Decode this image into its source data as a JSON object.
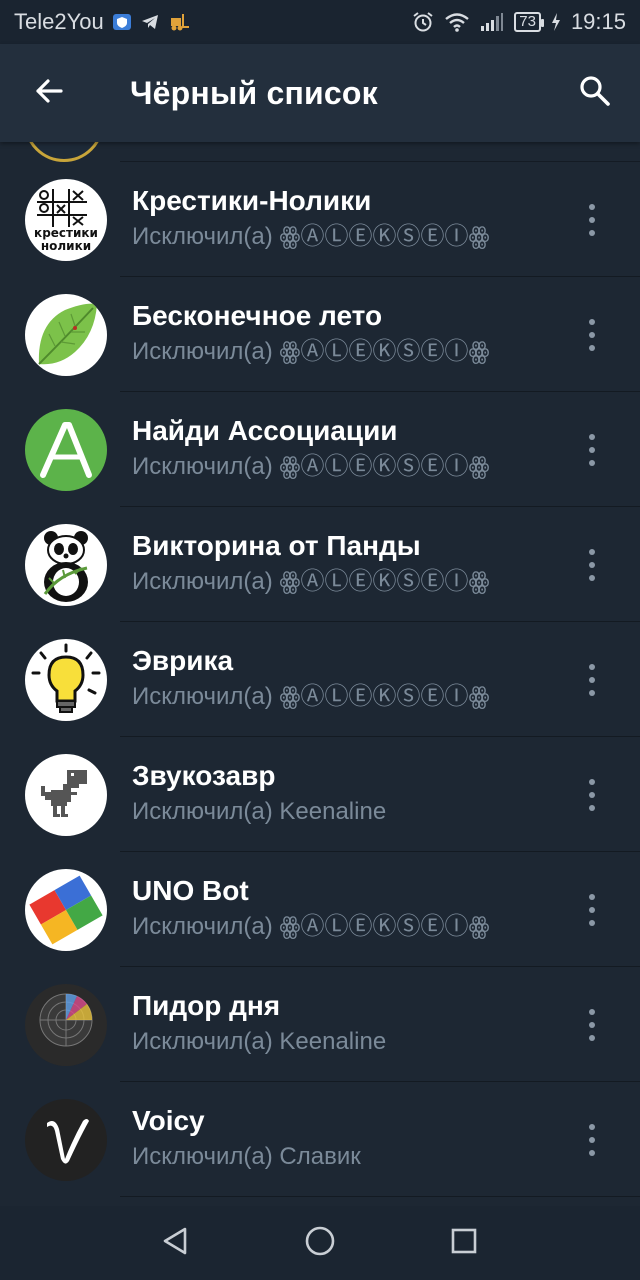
{
  "status_bar": {
    "carrier": "Tele2You",
    "battery": "73",
    "time": "19:15",
    "icons": [
      "shield-icon",
      "telegram-icon",
      "forklift-icon",
      "alarm-icon",
      "wifi-icon",
      "signal-icon",
      "charging-icon"
    ]
  },
  "appbar": {
    "title": "Чёрный список",
    "back_icon": "arrow-back-icon",
    "search_icon": "search-icon"
  },
  "items": [
    {
      "name": "Крестики-Нолики",
      "subtitle": "Исключил(а) ꙮⒶⓁⒺⓀⓈⒺⒾꙮ",
      "avatar": "tic-tac-toe"
    },
    {
      "name": "Бесконечное лето",
      "subtitle": "Исключил(а) ꙮⒶⓁⒺⓀⓈⒺⒾꙮ",
      "avatar": "leaf"
    },
    {
      "name": "Найди Ассоциации",
      "subtitle": "Исключил(а) ꙮⒶⓁⒺⓀⓈⒺⒾꙮ",
      "avatar": "letter-a"
    },
    {
      "name": "Викторина от Панды",
      "subtitle": "Исключил(а) ꙮⒶⓁⒺⓀⓈⒺⒾꙮ",
      "avatar": "panda"
    },
    {
      "name": "Эврика",
      "subtitle": "Исключил(а) ꙮⒶⓁⒺⓀⓈⒺⒾꙮ",
      "avatar": "light-bulb"
    },
    {
      "name": "Звукозавр",
      "subtitle": "Исключил(а) Keenaline",
      "avatar": "dino"
    },
    {
      "name": "UNO Bot",
      "subtitle": "Исключил(а) ꙮⒶⓁⒺⓀⓈⒺⒾꙮ",
      "avatar": "uno"
    },
    {
      "name": "Пидор дня",
      "subtitle": "Исключил(а) Keenaline",
      "avatar": "radar"
    },
    {
      "name": "Voicy",
      "subtitle": "Исключил(а) Славик",
      "avatar": "letter-v"
    }
  ],
  "navbar": {
    "icons": [
      "back-triangle-icon",
      "home-circle-icon",
      "recents-square-icon"
    ]
  }
}
